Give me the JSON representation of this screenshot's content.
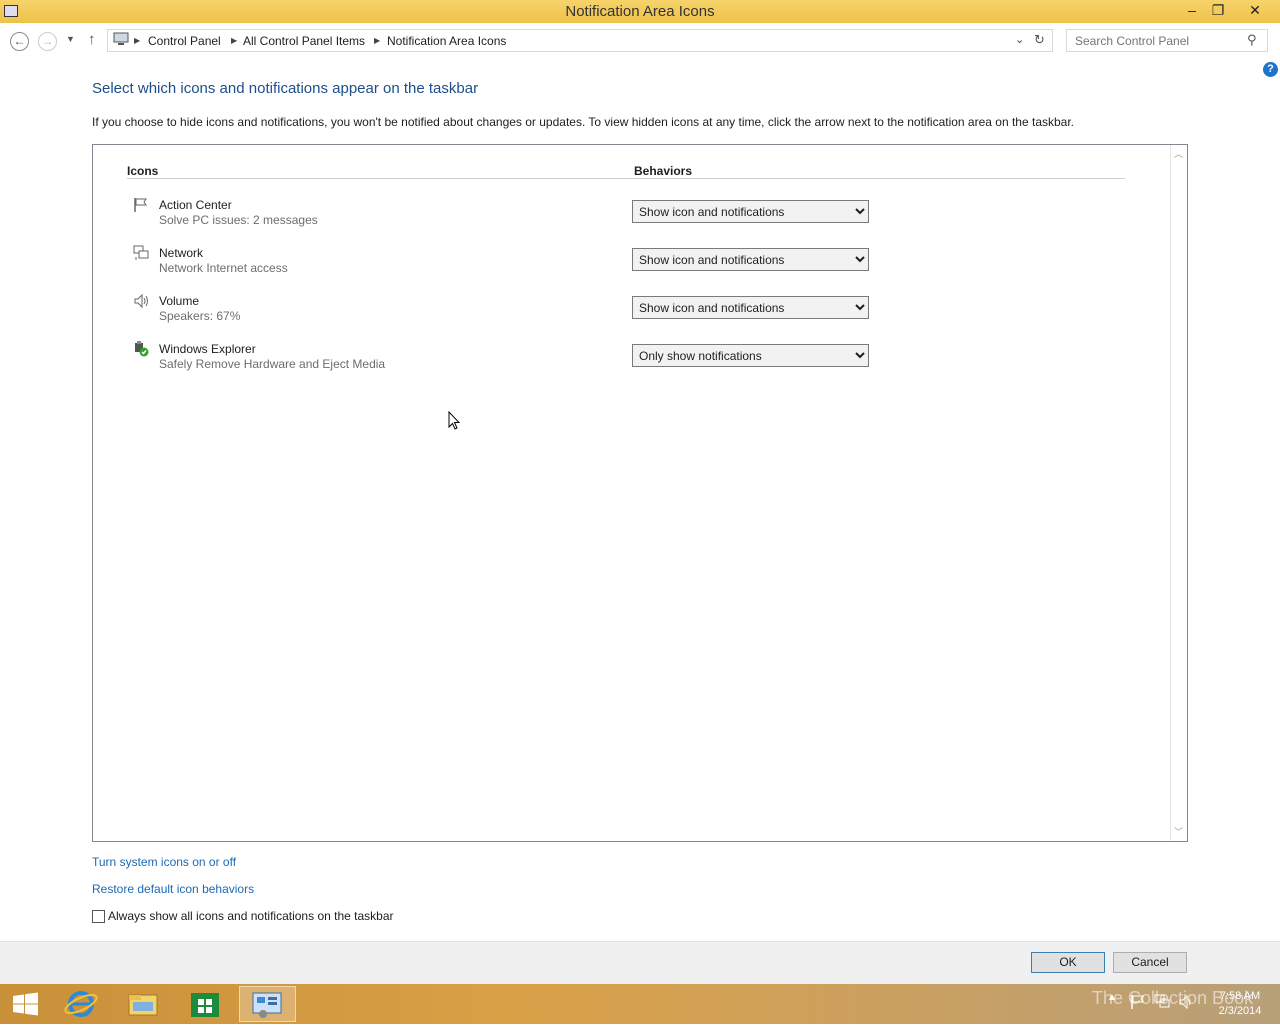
{
  "window": {
    "title": "Notification Area Icons",
    "minimize": "–",
    "restore": "❐",
    "close": "✕"
  },
  "breadcrumb": {
    "items": [
      "Control Panel",
      "All Control Panel Items",
      "Notification Area Icons"
    ]
  },
  "search": {
    "placeholder": "Search Control Panel"
  },
  "help": "?",
  "main": {
    "heading": "Select which icons and notifications appear on the taskbar",
    "description": "If you choose to hide icons and notifications, you won't be notified about changes or updates. To view hidden icons at any time, click the arrow next to the notification area on the taskbar.",
    "columns": {
      "icons": "Icons",
      "behaviors": "Behaviors"
    },
    "rows": [
      {
        "name": "Action Center",
        "detail": "Solve PC issues: 2 messages",
        "behavior": "Show icon and notifications",
        "icon": "flag-icon"
      },
      {
        "name": "Network",
        "detail": "Network Internet access",
        "behavior": "Show icon and notifications",
        "icon": "network-icon"
      },
      {
        "name": "Volume",
        "detail": "Speakers: 67%",
        "behavior": "Show icon and notifications",
        "icon": "speaker-icon"
      },
      {
        "name": "Windows Explorer",
        "detail": "Safely Remove Hardware and Eject Media",
        "behavior": "Only show notifications",
        "icon": "usb-eject-icon"
      }
    ]
  },
  "links": {
    "system_icons": "Turn system icons on or off",
    "restore_defaults": "Restore default icon behaviors"
  },
  "checkbox": {
    "label": "Always show all icons and notifications on the taskbar",
    "checked": false
  },
  "buttons": {
    "ok": "OK",
    "cancel": "Cancel"
  },
  "taskbar": {
    "time": "7:58 AM",
    "date": "2/3/2014",
    "watermark": "The Collection Book"
  },
  "colors": {
    "titlebar": "#f2c94c",
    "link": "#1e6ab4",
    "heading": "#1e4e8c",
    "taskbar": "#d9a046"
  }
}
